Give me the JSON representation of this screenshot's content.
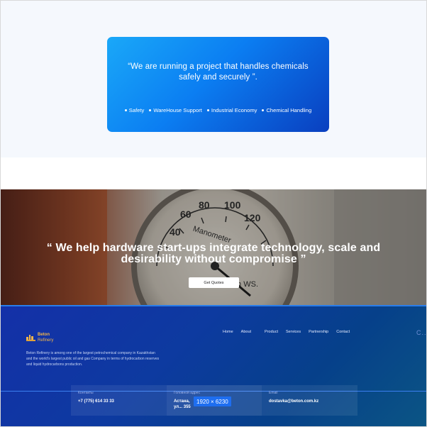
{
  "quote_card": {
    "text": "“We are running a project that handles chemicals safely and securely ”.",
    "tags": [
      "Safety",
      "WareHouse Support",
      "Industrial Economy",
      "Chemical Handling"
    ]
  },
  "hero": {
    "title": "“ We help hardware start-ups integrate technology, scale and desirability without compromise ”",
    "button_label": "Get Quotes",
    "gauge": {
      "dial_numbers": [
        "40",
        "60",
        "80",
        "100",
        "120"
      ],
      "dial_text": "Manometer",
      "dial_unit": "m WS."
    }
  },
  "footer": {
    "logo": {
      "name": "Beton",
      "sub": "Refinery"
    },
    "about": "Beton Refinery is among one of the largest petrochemical company in Kazakhstan and the world's largest public oil and gas Company in terms of hydrocarbon reserves and liquid hydrocarbons production.",
    "nav": [
      "Home",
      "About",
      "Product",
      "Services",
      "Partnership",
      "Contact"
    ],
    "nav_more": "C...",
    "contacts": [
      {
        "label": "Контакты",
        "value": "+7 (775) 614 33 33"
      },
      {
        "label": "Головной адрес",
        "value": "Астана, ул... 355"
      },
      {
        "label": "Email",
        "value": "dostavka@beton.com.kz"
      }
    ],
    "dimension_badge": "1920 × 6230"
  },
  "colors": {
    "card_gradient_start": "#1aa8f8",
    "card_gradient_end": "#0a3fbf",
    "footer_bg": "#1430a8",
    "logo_accent": "#f2b64a",
    "badge": "#1e6ef0"
  }
}
